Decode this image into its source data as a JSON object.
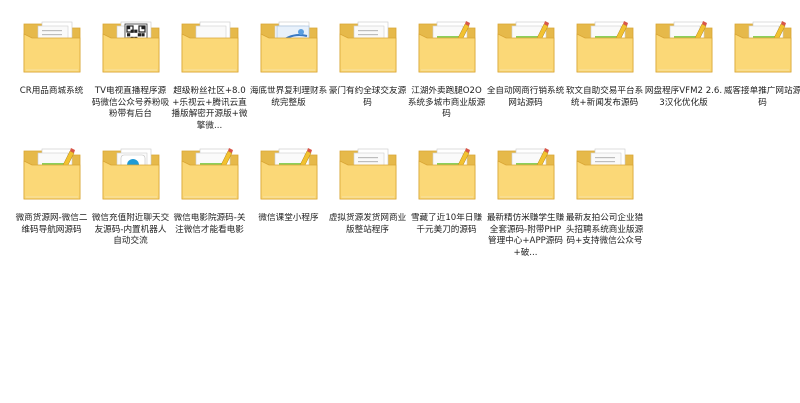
{
  "folders": [
    {
      "label": "CR用品商城系统",
      "preview": "docs"
    },
    {
      "label": "TV电视直播程序源码微信公众号养粉吸粉带有后台",
      "preview": "qr"
    },
    {
      "label": "超级粉丝社区+8.0+乐视云+腾讯云直播版解密开源版+微擎微...",
      "preview": "plain"
    },
    {
      "label": "海底世界复利理财系统完整版",
      "preview": "blue"
    },
    {
      "label": "豪门有约全球交友源码",
      "preview": "docs"
    },
    {
      "label": "江湖外卖跑腿O2O系统多城市商业版源码",
      "preview": "pencil"
    },
    {
      "label": "全自动网商行销系统网站源码",
      "preview": "pencil"
    },
    {
      "label": "软文自助交易平台系统+新闻发布源码",
      "preview": "pencil"
    },
    {
      "label": "网盘程序VFM2 2.6.3汉化优化版",
      "preview": "pencil"
    },
    {
      "label": "威客接单推广网站源码",
      "preview": "pencil"
    },
    {
      "label": "微商货源网-微信二维码导航网源码",
      "preview": "pencil"
    },
    {
      "label": "微信充值附近聊天交友源码-内置机器人自动交流",
      "preview": "app"
    },
    {
      "label": "微信电影院源码-关注微信才能看电影",
      "preview": "pencil"
    },
    {
      "label": "微信课堂小程序",
      "preview": "pencil"
    },
    {
      "label": "虚拟货源发货网商业版整站程序",
      "preview": "docs"
    },
    {
      "label": "雪藏了近10年日赚千元美刀的源码",
      "preview": "pencil"
    },
    {
      "label": "最新精仿米赚学生赚全套源码-附带PHP管理中心+APP源码+破...",
      "preview": "pencil"
    },
    {
      "label": "最新友拍公司企业猎头招聘系统商业版源码+支持微信公众号",
      "preview": "docs"
    }
  ],
  "colors": {
    "folder_back": "#e6b94a",
    "folder_front": "#fbd877",
    "folder_edge": "#d9a534",
    "label_text": "#1f1f1f",
    "background": "#ffffff"
  },
  "icon_type": "folder-icon"
}
